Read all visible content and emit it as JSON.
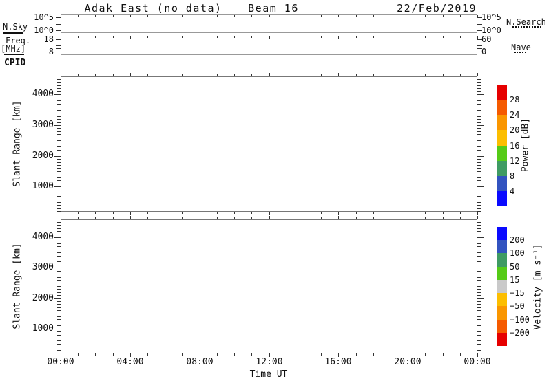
{
  "header": {
    "station_title": "Adak East (no data)",
    "beam_label": "Beam 16",
    "date_label": "22/Feb/2019"
  },
  "legend": {
    "nsky": "N.Sky",
    "nsearch": "N.Search",
    "freq1": "Freq.",
    "freq2": "[MHz]",
    "nave": "Nave",
    "cpid": "CPID"
  },
  "strip1": {
    "left_labels": [
      {
        "text": "10^5",
        "frac": 0.85
      },
      {
        "text": "10^0",
        "frac": 0.13
      }
    ],
    "right_labels": [
      {
        "text": "10^5",
        "frac": 0.85
      },
      {
        "text": "10^0",
        "frac": 0.13
      }
    ],
    "tick_fracs": [
      0.13,
      0.31,
      0.49,
      0.67,
      0.85
    ]
  },
  "strip2": {
    "left_labels": [
      {
        "text": "18",
        "frac": 0.82
      },
      {
        "text": "8",
        "frac": 0.18
      }
    ],
    "right_labels": [
      {
        "text": "60",
        "frac": 0.82
      },
      {
        "text": "0",
        "frac": 0.18
      }
    ],
    "tick_fracs": [
      0.18,
      0.34,
      0.5,
      0.66,
      0.82
    ]
  },
  "xaxis": {
    "label": "Time UT",
    "tick_labels": [
      "00:00",
      "04:00",
      "08:00",
      "12:00",
      "16:00",
      "20:00",
      "00:00"
    ],
    "total_hours": 24,
    "major_step_hours": 4,
    "minor_step_hours": 1
  },
  "yaxis": {
    "label": "Slant Range [km]",
    "range": [
      180,
      4590
    ],
    "major_ticks": [
      1000,
      2000,
      3000,
      4000
    ],
    "minor_step": 100
  },
  "power_colorbar": {
    "label": "Power [dB]",
    "segment_colors_top_to_bottom": [
      "#e60000",
      "#f55a00",
      "#fa9600",
      "#fcbe00",
      "#55cb17",
      "#3f9b63",
      "#3253c0",
      "#0a0aff"
    ],
    "boundary_labels_top_to_bottom": [
      "28",
      "24",
      "20",
      "16",
      "12",
      "8",
      "4"
    ]
  },
  "velocity_colorbar": {
    "label": "Velocity [m s⁻¹]",
    "segment_colors_top_to_bottom": [
      "#0a0aff",
      "#3253c0",
      "#3f9b63",
      "#55cb17",
      "#c9c9c9",
      "#fcbe00",
      "#fa9600",
      "#f55a00",
      "#e60000"
    ],
    "boundary_labels_top_to_bottom": [
      "200",
      "100",
      "50",
      "15",
      "−15",
      "−50",
      "−100",
      "−200"
    ]
  },
  "chart_data": [
    {
      "type": "line",
      "title": "Sky noise / search noise strip",
      "x": [],
      "series": [
        {
          "name": "N.Sky",
          "line_style": "solid",
          "values": []
        },
        {
          "name": "N.Search",
          "line_style": "dotted",
          "values": []
        }
      ],
      "yscale": "log",
      "ytick_labels": [
        "10^0",
        "10^5"
      ],
      "xlim_hours": [
        0,
        24
      ],
      "note": "no data plotted"
    },
    {
      "type": "line",
      "title": "Frequency / Nave strip",
      "x": [],
      "series": [
        {
          "name": "Freq [MHz]",
          "axis": "left",
          "line_style": "solid",
          "values": []
        },
        {
          "name": "Nave",
          "axis": "right",
          "line_style": "dotted",
          "values": []
        }
      ],
      "left_yticks": [
        8,
        18
      ],
      "right_yticks": [
        0,
        60
      ],
      "xlim_hours": [
        0,
        24
      ],
      "note": "no data plotted"
    },
    {
      "type": "heatmap",
      "title": "Power",
      "xlabel": "Time UT",
      "ylabel": "Slant Range [km]",
      "xlim_hours": [
        0,
        24
      ],
      "xtick_labels": [
        "00:00",
        "04:00",
        "08:00",
        "12:00",
        "16:00",
        "20:00",
        "00:00"
      ],
      "ylim": [
        180,
        4590
      ],
      "yticks": [
        1000,
        2000,
        3000,
        4000
      ],
      "colorbar_label": "Power [dB]",
      "color_levels": [
        4,
        8,
        12,
        16,
        20,
        24,
        28
      ],
      "values": [],
      "note": "no data plotted"
    },
    {
      "type": "heatmap",
      "title": "Velocity",
      "xlabel": "Time UT",
      "ylabel": "Slant Range [km]",
      "xlim_hours": [
        0,
        24
      ],
      "xtick_labels": [
        "00:00",
        "04:00",
        "08:00",
        "12:00",
        "16:00",
        "20:00",
        "00:00"
      ],
      "ylim": [
        180,
        4590
      ],
      "yticks": [
        1000,
        2000,
        3000,
        4000
      ],
      "colorbar_label": "Velocity [m s⁻¹]",
      "color_levels": [
        -200,
        -100,
        -50,
        -15,
        15,
        50,
        100,
        200
      ],
      "values": [],
      "note": "no data plotted"
    }
  ]
}
